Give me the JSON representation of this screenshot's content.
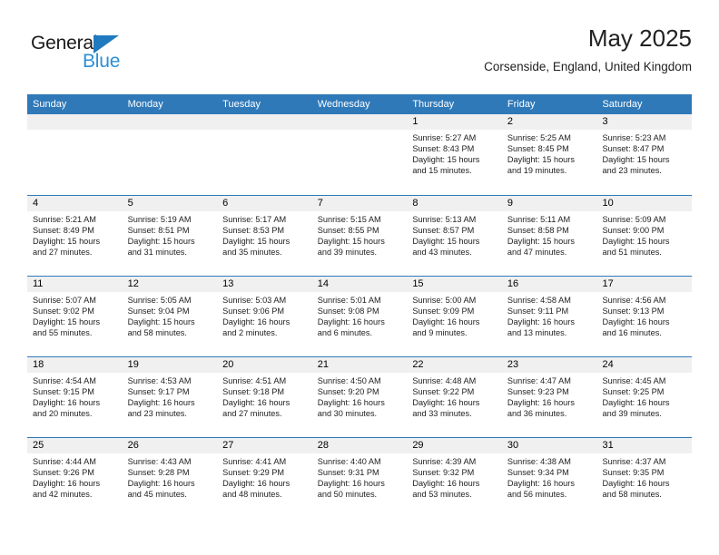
{
  "brand": {
    "word_top": "General",
    "word_bottom": "Blue",
    "triangle_color": "#1f7ac0",
    "blue_color": "#2b8fd6"
  },
  "header": {
    "title": "May 2025",
    "subtitle": "Corsenside, England, United Kingdom"
  },
  "theme": {
    "header_blue": "#2f79b9",
    "daynum_band": "#f0f0f0",
    "text": "#222222"
  },
  "weekdays": [
    "Sunday",
    "Monday",
    "Tuesday",
    "Wednesday",
    "Thursday",
    "Friday",
    "Saturday"
  ],
  "labels": {
    "sunrise": "Sunrise:",
    "sunset": "Sunset:",
    "daylight": "Daylight:"
  },
  "weeks": [
    [
      {
        "day": "",
        "sunrise": "",
        "sunset": "",
        "daylight_1": "",
        "daylight_2": ""
      },
      {
        "day": "",
        "sunrise": "",
        "sunset": "",
        "daylight_1": "",
        "daylight_2": ""
      },
      {
        "day": "",
        "sunrise": "",
        "sunset": "",
        "daylight_1": "",
        "daylight_2": ""
      },
      {
        "day": "",
        "sunrise": "",
        "sunset": "",
        "daylight_1": "",
        "daylight_2": ""
      },
      {
        "day": "1",
        "sunrise": "Sunrise: 5:27 AM",
        "sunset": "Sunset: 8:43 PM",
        "daylight_1": "Daylight: 15 hours",
        "daylight_2": "and 15 minutes."
      },
      {
        "day": "2",
        "sunrise": "Sunrise: 5:25 AM",
        "sunset": "Sunset: 8:45 PM",
        "daylight_1": "Daylight: 15 hours",
        "daylight_2": "and 19 minutes."
      },
      {
        "day": "3",
        "sunrise": "Sunrise: 5:23 AM",
        "sunset": "Sunset: 8:47 PM",
        "daylight_1": "Daylight: 15 hours",
        "daylight_2": "and 23 minutes."
      }
    ],
    [
      {
        "day": "4",
        "sunrise": "Sunrise: 5:21 AM",
        "sunset": "Sunset: 8:49 PM",
        "daylight_1": "Daylight: 15 hours",
        "daylight_2": "and 27 minutes."
      },
      {
        "day": "5",
        "sunrise": "Sunrise: 5:19 AM",
        "sunset": "Sunset: 8:51 PM",
        "daylight_1": "Daylight: 15 hours",
        "daylight_2": "and 31 minutes."
      },
      {
        "day": "6",
        "sunrise": "Sunrise: 5:17 AM",
        "sunset": "Sunset: 8:53 PM",
        "daylight_1": "Daylight: 15 hours",
        "daylight_2": "and 35 minutes."
      },
      {
        "day": "7",
        "sunrise": "Sunrise: 5:15 AM",
        "sunset": "Sunset: 8:55 PM",
        "daylight_1": "Daylight: 15 hours",
        "daylight_2": "and 39 minutes."
      },
      {
        "day": "8",
        "sunrise": "Sunrise: 5:13 AM",
        "sunset": "Sunset: 8:57 PM",
        "daylight_1": "Daylight: 15 hours",
        "daylight_2": "and 43 minutes."
      },
      {
        "day": "9",
        "sunrise": "Sunrise: 5:11 AM",
        "sunset": "Sunset: 8:58 PM",
        "daylight_1": "Daylight: 15 hours",
        "daylight_2": "and 47 minutes."
      },
      {
        "day": "10",
        "sunrise": "Sunrise: 5:09 AM",
        "sunset": "Sunset: 9:00 PM",
        "daylight_1": "Daylight: 15 hours",
        "daylight_2": "and 51 minutes."
      }
    ],
    [
      {
        "day": "11",
        "sunrise": "Sunrise: 5:07 AM",
        "sunset": "Sunset: 9:02 PM",
        "daylight_1": "Daylight: 15 hours",
        "daylight_2": "and 55 minutes."
      },
      {
        "day": "12",
        "sunrise": "Sunrise: 5:05 AM",
        "sunset": "Sunset: 9:04 PM",
        "daylight_1": "Daylight: 15 hours",
        "daylight_2": "and 58 minutes."
      },
      {
        "day": "13",
        "sunrise": "Sunrise: 5:03 AM",
        "sunset": "Sunset: 9:06 PM",
        "daylight_1": "Daylight: 16 hours",
        "daylight_2": "and 2 minutes."
      },
      {
        "day": "14",
        "sunrise": "Sunrise: 5:01 AM",
        "sunset": "Sunset: 9:08 PM",
        "daylight_1": "Daylight: 16 hours",
        "daylight_2": "and 6 minutes."
      },
      {
        "day": "15",
        "sunrise": "Sunrise: 5:00 AM",
        "sunset": "Sunset: 9:09 PM",
        "daylight_1": "Daylight: 16 hours",
        "daylight_2": "and 9 minutes."
      },
      {
        "day": "16",
        "sunrise": "Sunrise: 4:58 AM",
        "sunset": "Sunset: 9:11 PM",
        "daylight_1": "Daylight: 16 hours",
        "daylight_2": "and 13 minutes."
      },
      {
        "day": "17",
        "sunrise": "Sunrise: 4:56 AM",
        "sunset": "Sunset: 9:13 PM",
        "daylight_1": "Daylight: 16 hours",
        "daylight_2": "and 16 minutes."
      }
    ],
    [
      {
        "day": "18",
        "sunrise": "Sunrise: 4:54 AM",
        "sunset": "Sunset: 9:15 PM",
        "daylight_1": "Daylight: 16 hours",
        "daylight_2": "and 20 minutes."
      },
      {
        "day": "19",
        "sunrise": "Sunrise: 4:53 AM",
        "sunset": "Sunset: 9:17 PM",
        "daylight_1": "Daylight: 16 hours",
        "daylight_2": "and 23 minutes."
      },
      {
        "day": "20",
        "sunrise": "Sunrise: 4:51 AM",
        "sunset": "Sunset: 9:18 PM",
        "daylight_1": "Daylight: 16 hours",
        "daylight_2": "and 27 minutes."
      },
      {
        "day": "21",
        "sunrise": "Sunrise: 4:50 AM",
        "sunset": "Sunset: 9:20 PM",
        "daylight_1": "Daylight: 16 hours",
        "daylight_2": "and 30 minutes."
      },
      {
        "day": "22",
        "sunrise": "Sunrise: 4:48 AM",
        "sunset": "Sunset: 9:22 PM",
        "daylight_1": "Daylight: 16 hours",
        "daylight_2": "and 33 minutes."
      },
      {
        "day": "23",
        "sunrise": "Sunrise: 4:47 AM",
        "sunset": "Sunset: 9:23 PM",
        "daylight_1": "Daylight: 16 hours",
        "daylight_2": "and 36 minutes."
      },
      {
        "day": "24",
        "sunrise": "Sunrise: 4:45 AM",
        "sunset": "Sunset: 9:25 PM",
        "daylight_1": "Daylight: 16 hours",
        "daylight_2": "and 39 minutes."
      }
    ],
    [
      {
        "day": "25",
        "sunrise": "Sunrise: 4:44 AM",
        "sunset": "Sunset: 9:26 PM",
        "daylight_1": "Daylight: 16 hours",
        "daylight_2": "and 42 minutes."
      },
      {
        "day": "26",
        "sunrise": "Sunrise: 4:43 AM",
        "sunset": "Sunset: 9:28 PM",
        "daylight_1": "Daylight: 16 hours",
        "daylight_2": "and 45 minutes."
      },
      {
        "day": "27",
        "sunrise": "Sunrise: 4:41 AM",
        "sunset": "Sunset: 9:29 PM",
        "daylight_1": "Daylight: 16 hours",
        "daylight_2": "and 48 minutes."
      },
      {
        "day": "28",
        "sunrise": "Sunrise: 4:40 AM",
        "sunset": "Sunset: 9:31 PM",
        "daylight_1": "Daylight: 16 hours",
        "daylight_2": "and 50 minutes."
      },
      {
        "day": "29",
        "sunrise": "Sunrise: 4:39 AM",
        "sunset": "Sunset: 9:32 PM",
        "daylight_1": "Daylight: 16 hours",
        "daylight_2": "and 53 minutes."
      },
      {
        "day": "30",
        "sunrise": "Sunrise: 4:38 AM",
        "sunset": "Sunset: 9:34 PM",
        "daylight_1": "Daylight: 16 hours",
        "daylight_2": "and 56 minutes."
      },
      {
        "day": "31",
        "sunrise": "Sunrise: 4:37 AM",
        "sunset": "Sunset: 9:35 PM",
        "daylight_1": "Daylight: 16 hours",
        "daylight_2": "and 58 minutes."
      }
    ]
  ]
}
